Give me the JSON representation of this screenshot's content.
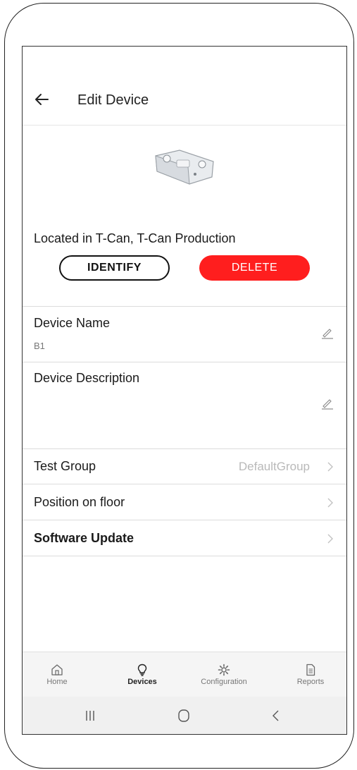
{
  "header": {
    "title": "Edit Device",
    "back_icon": "arrow-left-icon"
  },
  "device": {
    "image_icon": "emergency-light-fixture",
    "location": "Located in T-Can, T-Can Production"
  },
  "actions": {
    "identify_label": "IDENTIFY",
    "delete_label": "DELETE",
    "delete_color": "#ff1e1e"
  },
  "fields": {
    "name": {
      "label": "Device Name",
      "value": "B1",
      "icon": "pencil-icon"
    },
    "description": {
      "label": "Device Description",
      "value": "",
      "icon": "pencil-icon"
    }
  },
  "rows": [
    {
      "label": "Test Group",
      "value": "DefaultGroup",
      "icon": "chevron-right-icon"
    },
    {
      "label": "Position on floor",
      "value": "",
      "icon": "chevron-right-icon"
    },
    {
      "label": "Software Update",
      "value": "",
      "icon": "chevron-right-icon"
    }
  ],
  "bottom_nav": [
    {
      "label": "Home",
      "icon": "home-icon",
      "active": false
    },
    {
      "label": "Devices",
      "icon": "lightbulb-icon",
      "active": true
    },
    {
      "label": "Configuration",
      "icon": "gear-icon",
      "active": false
    },
    {
      "label": "Reports",
      "icon": "document-icon",
      "active": false
    }
  ],
  "system_nav": [
    {
      "icon": "recent-apps-icon"
    },
    {
      "icon": "home-circle-icon"
    },
    {
      "icon": "back-chevron-icon"
    }
  ]
}
